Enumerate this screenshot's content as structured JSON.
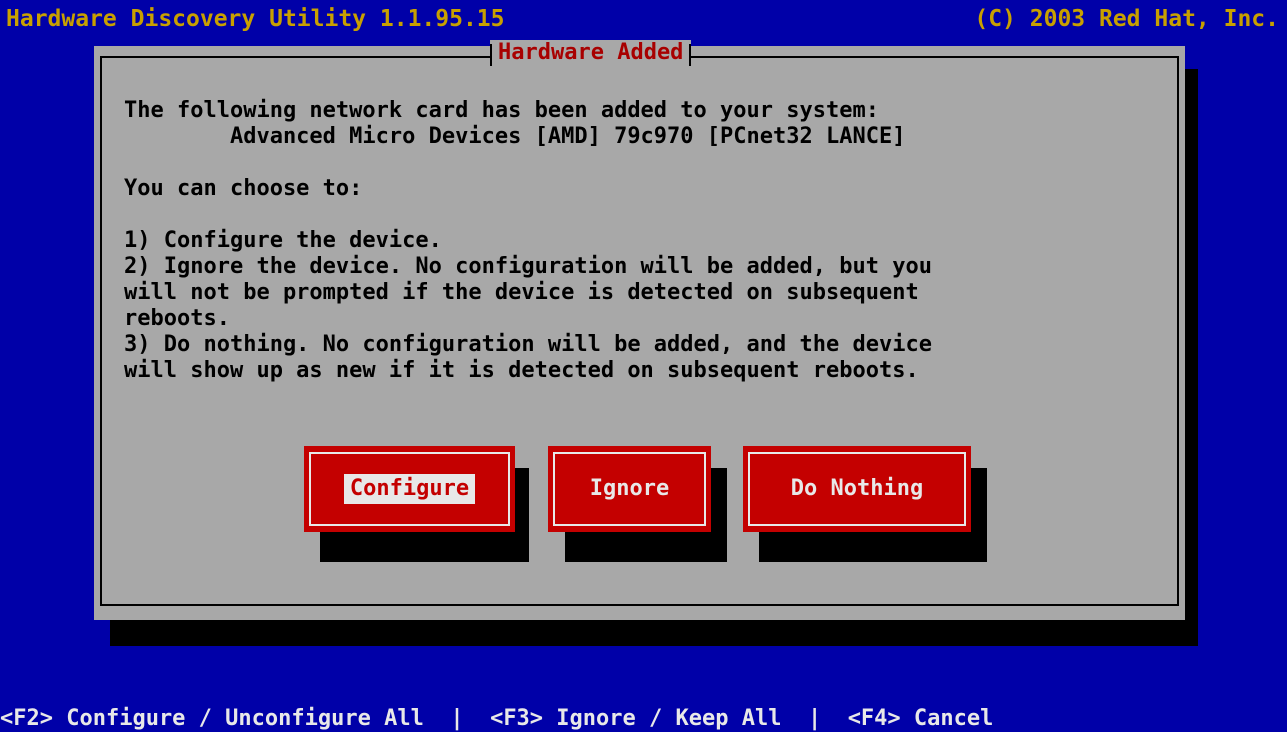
{
  "topbar": {
    "left": "Hardware Discovery Utility 1.1.95.15",
    "right": "(C) 2003 Red Hat, Inc."
  },
  "dialog": {
    "title": "Hardware Added",
    "text": "The following network card has been added to your system:\n        Advanced Micro Devices [AMD] 79c970 [PCnet32 LANCE]\n\nYou can choose to:\n\n1) Configure the device.\n2) Ignore the device. No configuration will be added, but you\nwill not be prompted if the device is detected on subsequent\nreboots.\n3) Do nothing. No configuration will be added, and the device\nwill show up as new if it is detected on subsequent reboots.",
    "buttons": {
      "configure": "Configure",
      "ignore": "Ignore",
      "do_nothing": "Do Nothing"
    },
    "focused_button": "configure"
  },
  "statusbar": {
    "text": "<F2> Configure / Unconfigure All  |  <F3> Ignore / Keep All  |  <F4> Cancel"
  },
  "colors": {
    "background": "#0000a8",
    "title_text": "#c8a000",
    "dialog": "#a8a8a8",
    "dialog_title": "#a80000",
    "button": "#c40000",
    "button_text": "#e8e8e8",
    "shadow": "#000000"
  }
}
